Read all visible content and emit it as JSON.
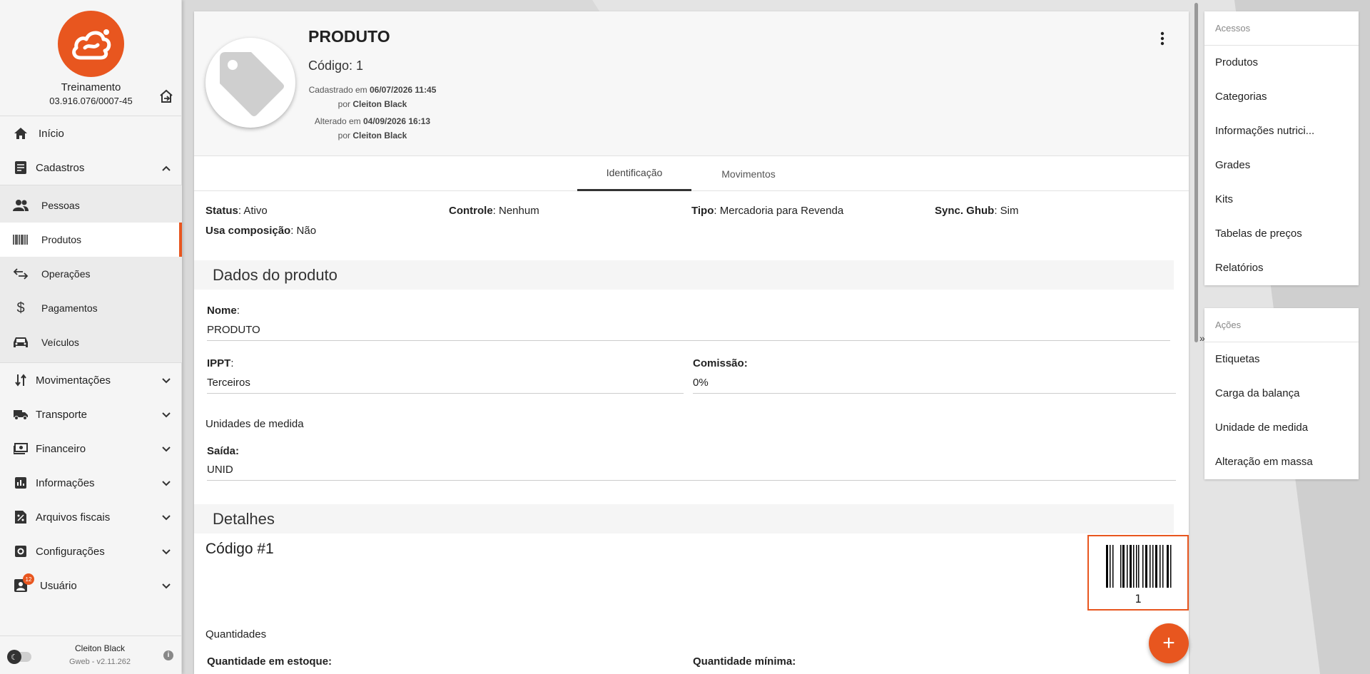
{
  "sidebar": {
    "company_name": "Treinamento",
    "company_cnpj": "03.916.076/0007-45",
    "nav": {
      "inicio": "Início",
      "cadastros": "Cadastros",
      "pessoas": "Pessoas",
      "produtos": "Produtos",
      "operacoes": "Operações",
      "pagamentos": "Pagamentos",
      "veiculos": "Veículos",
      "movimentacoes": "Movimentações",
      "transporte": "Transporte",
      "financeiro": "Financeiro",
      "informacoes": "Informações",
      "arquivos_fiscais": "Arquivos fiscais",
      "configuracoes": "Configurações",
      "usuario": "Usuário",
      "usuario_badge": "12"
    },
    "footer": {
      "user": "Cleiton Black",
      "version": "Gweb - v2.11.262"
    }
  },
  "product": {
    "title": "PRODUTO",
    "code": "Código: 1",
    "created_prefix": "Cadastrado em",
    "created_at": "06/07/2026 11:45",
    "created_by_prefix": "por",
    "created_by": "Cleiton Black",
    "updated_prefix": "Alterado em",
    "updated_at": "04/09/2026 16:13",
    "updated_by_prefix": "por",
    "updated_by": "Cleiton Black"
  },
  "tabs": {
    "identificacao": "Identificação",
    "movimentos": "Movimentos"
  },
  "status": {
    "status_label": "Status",
    "status_value": ": Ativo",
    "controle_label": "Controle",
    "controle_value": ": Nenhum",
    "tipo_label": "Tipo",
    "tipo_value": ": Mercadoria para Revenda",
    "sync_label": "Sync. Ghub",
    "sync_value": ": Sim",
    "composicao_label": "Usa composição",
    "composicao_value": ": Não"
  },
  "dados": {
    "section_title": "Dados do produto",
    "nome_label": "Nome",
    "nome_value": "PRODUTO",
    "ippt_label": "IPPT",
    "ippt_value": "Terceiros",
    "comissao_label": "Comissão:",
    "comissao_value": "0%",
    "unidades_title": "Unidades de medida",
    "saida_label": "Saída:",
    "saida_value": "UNID",
    "colon": ":"
  },
  "detalhes": {
    "section_title": "Detalhes",
    "codigo_title": "Código #1",
    "barcode_value": "1",
    "quantidades_title": "Quantidades",
    "qtd_estoque_label": "Quantidade em estoque:",
    "qtd_minima_label": "Quantidade mínima:"
  },
  "acessos": {
    "title": "Acessos",
    "items": [
      "Produtos",
      "Categorias",
      "Informações nutrici...",
      "Grades",
      "Kits",
      "Tabelas de preços",
      "Relatórios"
    ]
  },
  "acoes": {
    "title": "Ações",
    "items": [
      "Etiquetas",
      "Carga da balança",
      "Unidade de medida",
      "Alteração em massa"
    ]
  },
  "fab_label": "+",
  "collapse_label": "»",
  "colors": {
    "accent": "#e8561f"
  }
}
